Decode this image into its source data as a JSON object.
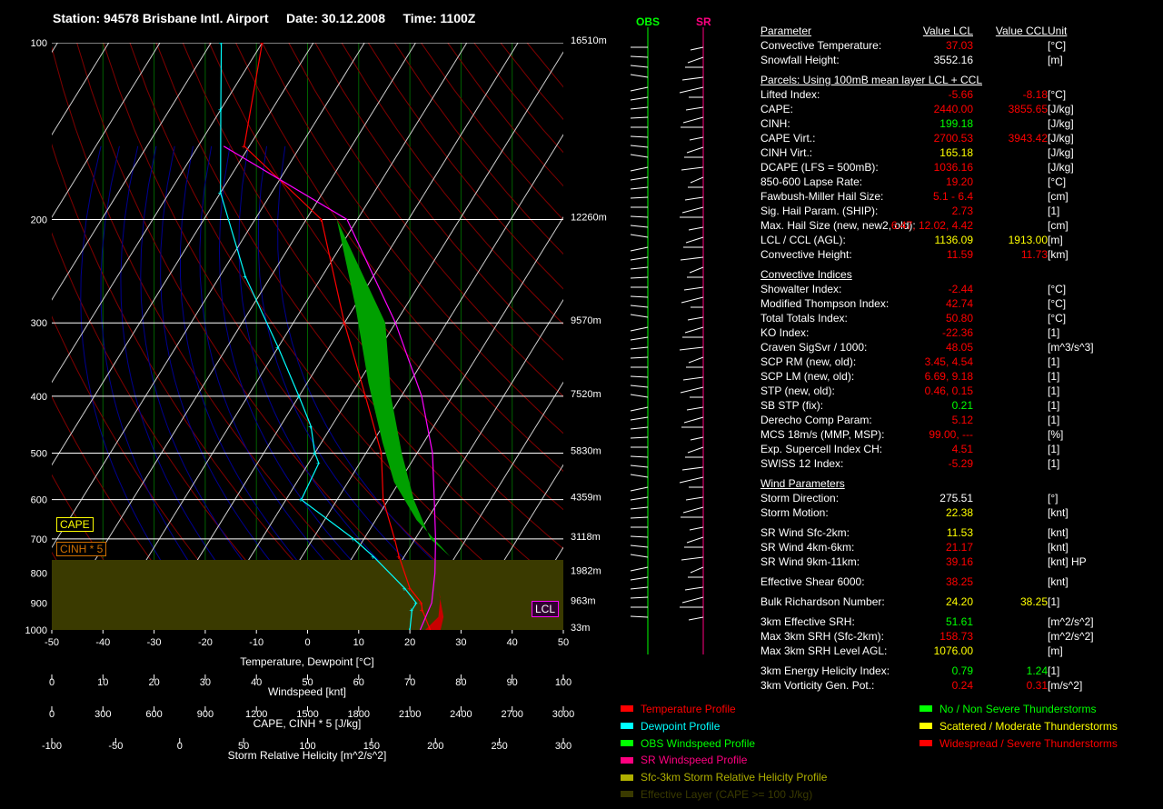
{
  "header": {
    "station_label": "Station:",
    "station": "94578 Brisbane Intl. Airport",
    "date_label": "Date:",
    "date": "30.12.2008",
    "time_label": "Time:",
    "time": "1100Z"
  },
  "colors": {
    "temperature": "#ff0000",
    "dewpoint": "#00ffff",
    "obs_wind": "#00ff00",
    "sr_wind": "#ff0080",
    "srh": "#b0b000",
    "effective_layer": "#3a3a00",
    "cape_fill": "#00a000",
    "cinh_fill": "#c80000",
    "value_red": "#ff0000",
    "value_yellow": "#ffff00",
    "value_green": "#00ff00",
    "value_white": "#ffffff"
  },
  "chart_data": {
    "type": "line",
    "title": "Skew-T Log-P sounding",
    "pressure_levels": [
      100,
      200,
      300,
      400,
      500,
      600,
      700,
      800,
      900,
      1000
    ],
    "height_labels": [
      "16510m",
      "12260m",
      "9570m",
      "7520m",
      "5830m",
      "4359m",
      "3118m",
      "1982m",
      "963m",
      "33m"
    ],
    "height_label_pressures": [
      100,
      200,
      300,
      400,
      500,
      600,
      700,
      800,
      900,
      1000
    ],
    "xlim": [
      -50,
      50
    ],
    "xlabel": "Temperature, Dewpoint [°C]",
    "x_ticks": [
      "-50",
      "-40",
      "-30",
      "-20",
      "-10",
      "0",
      "10",
      "20",
      "30",
      "40",
      "50"
    ],
    "extra_axes": [
      {
        "label": "Windspeed [knt]",
        "ticks": [
          "0",
          "10",
          "20",
          "30",
          "40",
          "50",
          "60",
          "70",
          "80",
          "90",
          "100"
        ]
      },
      {
        "label": "CAPE, CINH * 5 [J/kg]",
        "ticks": [
          "0",
          "300",
          "600",
          "900",
          "1200",
          "1500",
          "1800",
          "2100",
          "2400",
          "2700",
          "3000"
        ]
      },
      {
        "label": "Storm Relative Helicity [m^2/s^2]",
        "ticks": [
          "-100",
          "-50",
          "0",
          "50",
          "100",
          "150",
          "200",
          "250",
          "300"
        ]
      }
    ],
    "series": [
      {
        "name": "Temperature Profile",
        "color": "#ff0000",
        "points": [
          [
            24,
            1000
          ],
          [
            20,
            925
          ],
          [
            19,
            900
          ],
          [
            15,
            850
          ],
          [
            9,
            750
          ],
          [
            6,
            700
          ],
          [
            -1,
            600
          ],
          [
            -7,
            500
          ],
          [
            -17,
            400
          ],
          [
            -30,
            300
          ],
          [
            -47,
            200
          ],
          [
            -71,
            150
          ],
          [
            -80,
            100
          ]
        ]
      },
      {
        "name": "Dewpoint Profile",
        "color": "#00ffff",
        "points": [
          [
            20,
            1000
          ],
          [
            18,
            925
          ],
          [
            18,
            900
          ],
          [
            14,
            850
          ],
          [
            4,
            750
          ],
          [
            -2,
            700
          ],
          [
            -17,
            600
          ],
          [
            -18,
            520
          ],
          [
            -20,
            500
          ],
          [
            -24,
            450
          ],
          [
            -30,
            400
          ],
          [
            -40,
            330
          ],
          [
            -55,
            250
          ],
          [
            -70,
            180
          ],
          [
            -80,
            130
          ],
          [
            -88,
            100
          ]
        ]
      }
    ],
    "legend": [
      {
        "label": "Temperature Profile",
        "color": "#ff0000"
      },
      {
        "label": "Dewpoint Profile",
        "color": "#00ffff"
      },
      {
        "label": "OBS Windspeed Profile",
        "color": "#00ff00"
      },
      {
        "label": "SR Windspeed Profile",
        "color": "#ff0080"
      },
      {
        "label": "Sfc-3km Storm Relative Helicity Profile",
        "color": "#b0b000"
      },
      {
        "label": "Effective Layer (CAPE >= 100 J/kg)",
        "color": "#3a3a00"
      }
    ],
    "annotations": {
      "cape": "CAPE",
      "cinh": "CINH * 5",
      "lcl": "LCL"
    },
    "grid": true
  },
  "hodo": {
    "obs_label": "OBS",
    "sr_label": "SR"
  },
  "params": {
    "header": {
      "name": "Parameter",
      "lcl": "Value LCL",
      "ccl": "Value CCL",
      "unit": "Unit"
    },
    "rows": [
      {
        "kind": "row",
        "name": "Convective Temperature:",
        "lcl": "37.03",
        "lcl_color": "#ff0000",
        "ccl": "",
        "ccl_color": "#ff0000",
        "unit": "[°C]"
      },
      {
        "kind": "row",
        "name": "Snowfall Height:",
        "lcl": "3552.16",
        "lcl_color": "#ffffff",
        "ccl": "",
        "ccl_color": "#ffffff",
        "unit": "[m]"
      },
      {
        "kind": "gap"
      },
      {
        "kind": "section",
        "name": "Parcels: Using 100mB mean layer LCL + CCL"
      },
      {
        "kind": "row",
        "name": "Lifted Index:",
        "lcl": "-5.66",
        "lcl_color": "#ff0000",
        "ccl": "-8.18",
        "ccl_color": "#ff0000",
        "unit": "[°C]"
      },
      {
        "kind": "row",
        "name": "CAPE:",
        "lcl": "2440.00",
        "lcl_color": "#ff0000",
        "ccl": "3855.65",
        "ccl_color": "#ff0000",
        "unit": "[J/kg]"
      },
      {
        "kind": "row",
        "name": "CINH:",
        "lcl": "199.18",
        "lcl_color": "#00ff00",
        "ccl": "",
        "ccl_color": "#00ff00",
        "unit": "[J/kg]"
      },
      {
        "kind": "row",
        "name": "CAPE Virt.:",
        "lcl": "2700.53",
        "lcl_color": "#ff0000",
        "ccl": "3943.42",
        "ccl_color": "#ff0000",
        "unit": "[J/kg]"
      },
      {
        "kind": "row",
        "name": "CINH Virt.:",
        "lcl": "165.18",
        "lcl_color": "#ffff00",
        "ccl": "",
        "ccl_color": "#ffff00",
        "unit": "[J/kg]"
      },
      {
        "kind": "row",
        "name": "DCAPE (LFS = 500mB):",
        "lcl": "1036.16",
        "lcl_color": "#ff0000",
        "ccl": "",
        "ccl_color": "#ff0000",
        "unit": "[J/kg]"
      },
      {
        "kind": "row",
        "name": "850-600 Lapse Rate:",
        "lcl": "19.20",
        "lcl_color": "#ff0000",
        "ccl": "",
        "ccl_color": "#ff0000",
        "unit": "[°C]"
      },
      {
        "kind": "row",
        "name": "Fawbush-Miller Hail Size:",
        "lcl": "5.1 - 6.4",
        "lcl_color": "#ff0000",
        "ccl": "",
        "ccl_color": "#ff0000",
        "unit": "[cm]"
      },
      {
        "kind": "row",
        "name": "Sig. Hail Param. (SHIP):",
        "lcl": "2.73",
        "lcl_color": "#ff0000",
        "ccl": "",
        "ccl_color": "#ff0000",
        "unit": "[1]"
      },
      {
        "kind": "row",
        "name": "Max. Hail Size (new, new2, old):",
        "lcl": "6.47, 12.02, 4.42",
        "lcl_color": "#ff0000",
        "ccl": "",
        "ccl_color": "#ff0000",
        "unit": "[cm]"
      },
      {
        "kind": "row",
        "name": "LCL / CCL (AGL):",
        "lcl": "1136.09",
        "lcl_color": "#ffff00",
        "ccl": "1913.00",
        "ccl_color": "#ffff00",
        "unit": "[m]"
      },
      {
        "kind": "row",
        "name": "Convective Height:",
        "lcl": "11.59",
        "lcl_color": "#ff0000",
        "ccl": "11.73",
        "ccl_color": "#ff0000",
        "unit": "[km]"
      },
      {
        "kind": "gap"
      },
      {
        "kind": "section",
        "name": "Convective Indices"
      },
      {
        "kind": "row",
        "name": "Showalter Index:",
        "lcl": "-2.44",
        "lcl_color": "#ff0000",
        "ccl": "",
        "ccl_color": "#ff0000",
        "unit": "[°C]"
      },
      {
        "kind": "row",
        "name": "Modified Thompson Index:",
        "lcl": "42.74",
        "lcl_color": "#ff0000",
        "ccl": "",
        "ccl_color": "#ff0000",
        "unit": "[°C]"
      },
      {
        "kind": "row",
        "name": "Total Totals Index:",
        "lcl": "50.80",
        "lcl_color": "#ff0000",
        "ccl": "",
        "ccl_color": "#ff0000",
        "unit": "[°C]"
      },
      {
        "kind": "row",
        "name": "KO Index:",
        "lcl": "-22.36",
        "lcl_color": "#ff0000",
        "ccl": "",
        "ccl_color": "#ff0000",
        "unit": "[1]"
      },
      {
        "kind": "row",
        "name": "Craven SigSvr / 1000:",
        "lcl": "48.05",
        "lcl_color": "#ff0000",
        "ccl": "",
        "ccl_color": "#ff0000",
        "unit": "[m^3/s^3]"
      },
      {
        "kind": "row",
        "name": "SCP RM (new, old):",
        "lcl": "3.45, 4.54",
        "lcl_color": "#ff0000",
        "ccl": "",
        "ccl_color": "#ff0000",
        "unit": "[1]"
      },
      {
        "kind": "row",
        "name": "SCP LM (new, old):",
        "lcl": "6.69, 9.18",
        "lcl_color": "#ff0000",
        "ccl": "",
        "ccl_color": "#ff0000",
        "unit": "[1]"
      },
      {
        "kind": "row",
        "name": "STP (new, old):",
        "lcl": "0.46, 0.15",
        "lcl_color": "#ff0000",
        "ccl": "",
        "ccl_color": "#ff0000",
        "unit": "[1]"
      },
      {
        "kind": "row",
        "name": "SB STP (fix):",
        "lcl": "0.21",
        "lcl_color": "#00ff00",
        "ccl": "",
        "ccl_color": "#00ff00",
        "unit": "[1]"
      },
      {
        "kind": "row",
        "name": "Derecho Comp Param:",
        "lcl": "5.12",
        "lcl_color": "#ff0000",
        "ccl": "",
        "ccl_color": "#ff0000",
        "unit": "[1]"
      },
      {
        "kind": "row",
        "name": "MCS 18m/s (MMP, MSP):",
        "lcl": "99.00, ---",
        "lcl_color": "#ff0000",
        "ccl": "",
        "ccl_color": "#ff0000",
        "unit": "[%]"
      },
      {
        "kind": "row",
        "name": "Exp. Supercell Index CH:",
        "lcl": "4.51",
        "lcl_color": "#ff0000",
        "ccl": "",
        "ccl_color": "#ff0000",
        "unit": "[1]"
      },
      {
        "kind": "row",
        "name": "SWISS 12 Index:",
        "lcl": "-5.29",
        "lcl_color": "#ff0000",
        "ccl": "",
        "ccl_color": "#ff0000",
        "unit": "[1]"
      },
      {
        "kind": "gap"
      },
      {
        "kind": "section",
        "name": "Wind Parameters"
      },
      {
        "kind": "row",
        "name": "Storm Direction:",
        "lcl": "275.51",
        "lcl_color": "#ffffff",
        "ccl": "",
        "ccl_color": "#ffffff",
        "unit": "[°]"
      },
      {
        "kind": "row",
        "name": "Storm Motion:",
        "lcl": "22.38",
        "lcl_color": "#ffff00",
        "ccl": "",
        "ccl_color": "#ffff00",
        "unit": "[knt]"
      },
      {
        "kind": "gap"
      },
      {
        "kind": "row",
        "name": "SR Wind Sfc-2km:",
        "lcl": "11.53",
        "lcl_color": "#ffff00",
        "ccl": "",
        "ccl_color": "#ffff00",
        "unit": "[knt]"
      },
      {
        "kind": "row",
        "name": "SR Wind 4km-6km:",
        "lcl": "21.17",
        "lcl_color": "#ff0000",
        "ccl": "",
        "ccl_color": "#ff0000",
        "unit": "[knt]"
      },
      {
        "kind": "row",
        "name": "SR Wind 9km-11km:",
        "lcl": "39.16",
        "lcl_color": "#ff0000",
        "ccl": "",
        "ccl_color": "#ff0000",
        "unit": "[knt] HP"
      },
      {
        "kind": "gap"
      },
      {
        "kind": "row",
        "name": "Effective Shear 6000:",
        "lcl": "38.25",
        "lcl_color": "#ff0000",
        "ccl": "",
        "ccl_color": "#ff0000",
        "unit": "[knt]"
      },
      {
        "kind": "gap"
      },
      {
        "kind": "row",
        "name": "Bulk Richardson Number:",
        "lcl": "24.20",
        "lcl_color": "#ffff00",
        "ccl": "38.25",
        "ccl_color": "#ffff00",
        "unit": "[1]"
      },
      {
        "kind": "gap"
      },
      {
        "kind": "row",
        "name": "3km Effective SRH:",
        "lcl": "51.61",
        "lcl_color": "#00ff00",
        "ccl": "",
        "ccl_color": "#00ff00",
        "unit": "[m^2/s^2]"
      },
      {
        "kind": "row",
        "name": "Max 3km SRH (Sfc-2km):",
        "lcl": "158.73",
        "lcl_color": "#ff0000",
        "ccl": "",
        "ccl_color": "#ff0000",
        "unit": "[m^2/s^2]"
      },
      {
        "kind": "row",
        "name": "Max 3km SRH Level AGL:",
        "lcl": "1076.00",
        "lcl_color": "#ffff00",
        "ccl": "",
        "ccl_color": "#ffff00",
        "unit": "[m]"
      },
      {
        "kind": "gap"
      },
      {
        "kind": "row",
        "name": "3km Energy Helicity Index:",
        "lcl": "0.79",
        "lcl_color": "#00ff00",
        "ccl": "1.24",
        "ccl_color": "#00ff00",
        "unit": "[1]"
      },
      {
        "kind": "row",
        "name": "3km Vorticity Gen. Pot.:",
        "lcl": "0.24",
        "lcl_color": "#ff0000",
        "ccl": "0.31",
        "ccl_color": "#ff0000",
        "unit": "[m/s^2]"
      }
    ]
  },
  "threat_legend": [
    {
      "label": "No / Non Severe Thunderstorms",
      "color": "#00ff00"
    },
    {
      "label": "Scattered / Moderate Thunderstorms",
      "color": "#ffff00"
    },
    {
      "label": "Widespread / Severe Thunderstorms",
      "color": "#ff0000"
    }
  ]
}
